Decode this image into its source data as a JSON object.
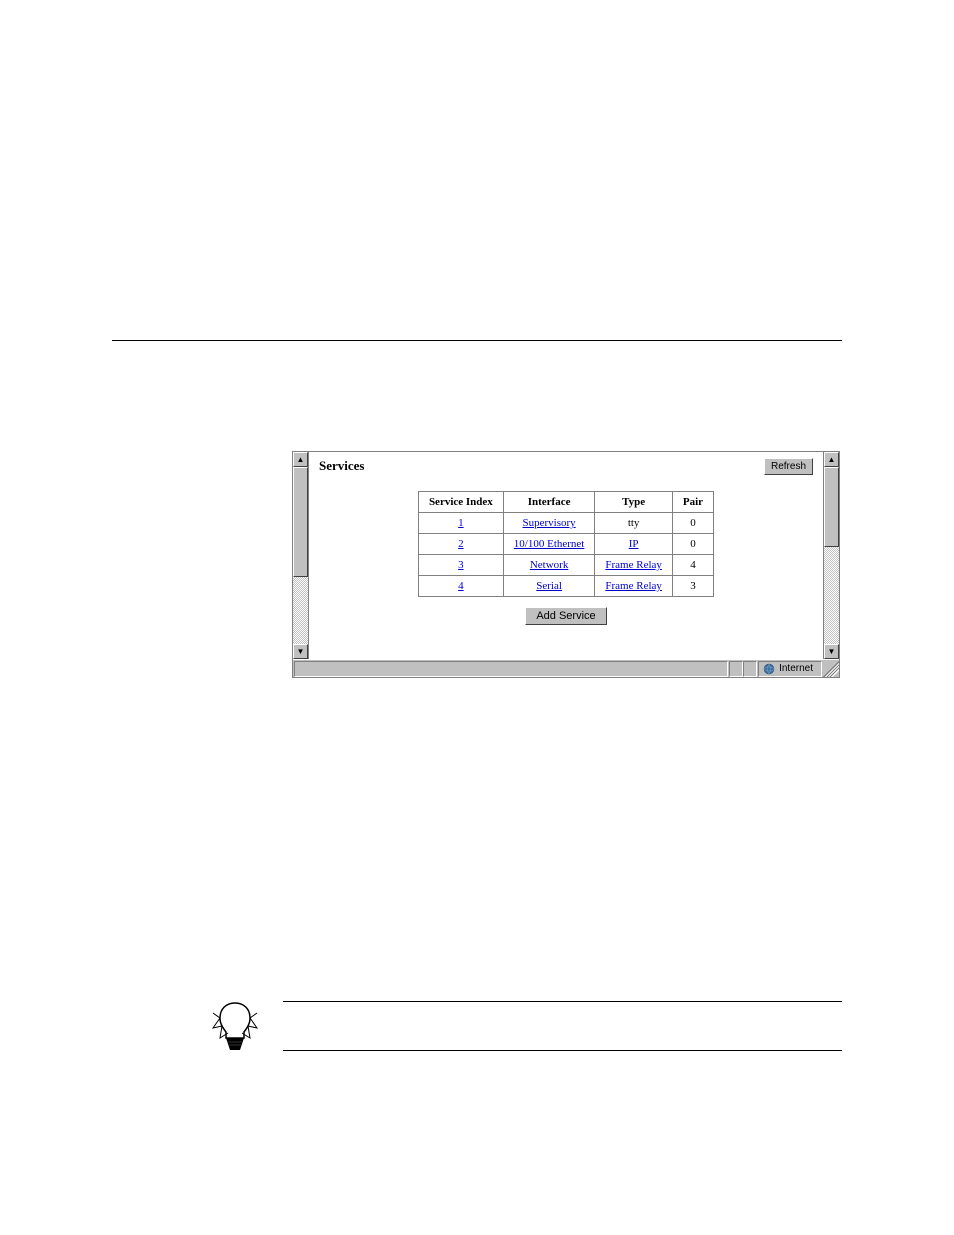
{
  "section_title": "Services",
  "refresh_label": "Refresh",
  "add_service_label": "Add Service",
  "status_text": "Internet",
  "table": {
    "headers": {
      "service_index": "Service Index",
      "interface": "Interface",
      "type": "Type",
      "pair": "Pair"
    },
    "rows": [
      {
        "index": "1",
        "interface": "Supervisory",
        "type": "tty",
        "pair": "0",
        "type_link": false
      },
      {
        "index": "2",
        "interface": "10/100 Ethernet",
        "type": "IP",
        "pair": "0",
        "type_link": true
      },
      {
        "index": "3",
        "interface": "Network",
        "type": "Frame Relay",
        "pair": "4",
        "type_link": true
      },
      {
        "index": "4",
        "interface": "Serial",
        "type": "Frame Relay",
        "pair": "3",
        "type_link": true
      }
    ]
  }
}
